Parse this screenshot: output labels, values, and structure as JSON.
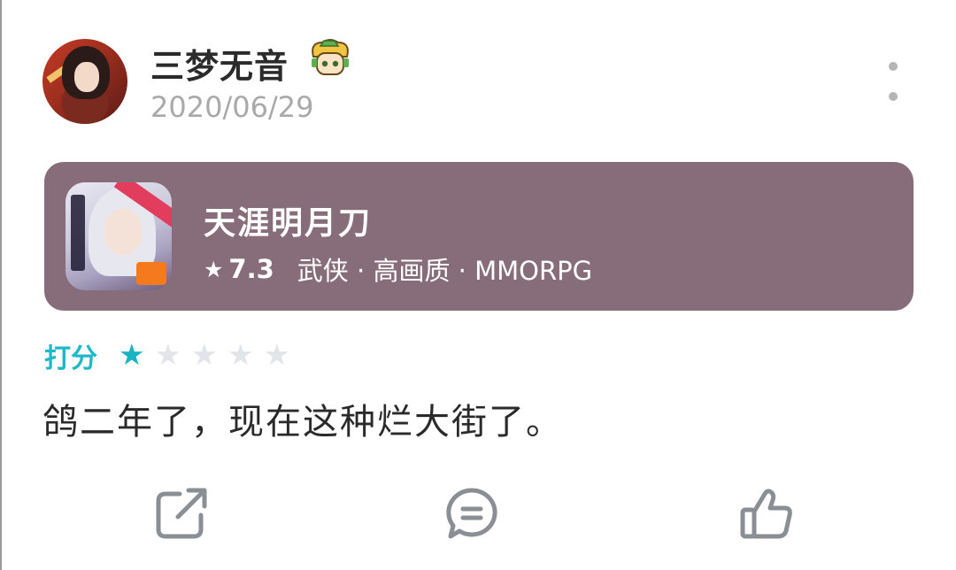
{
  "post": {
    "username": "三梦无音",
    "date": "2020/06/29",
    "avatar_icon": "anime-warrior-avatar",
    "badge_icon": "elf-character-badge-icon"
  },
  "game": {
    "title": "天涯明月刀",
    "rating": "7.3",
    "tags": "武侠 · 高画质 · MMORPG",
    "card_color": "#876d79",
    "icon": "game-art-icon"
  },
  "rating": {
    "label": "打分",
    "stars_filled": 1,
    "stars_total": 5,
    "accent_color": "#17b4c4"
  },
  "review": {
    "text": "鸽二年了，现在这种烂大街了。"
  },
  "actions": {
    "share_icon": "share-icon",
    "comment_icon": "comment-icon",
    "like_icon": "thumbs-up-icon"
  }
}
